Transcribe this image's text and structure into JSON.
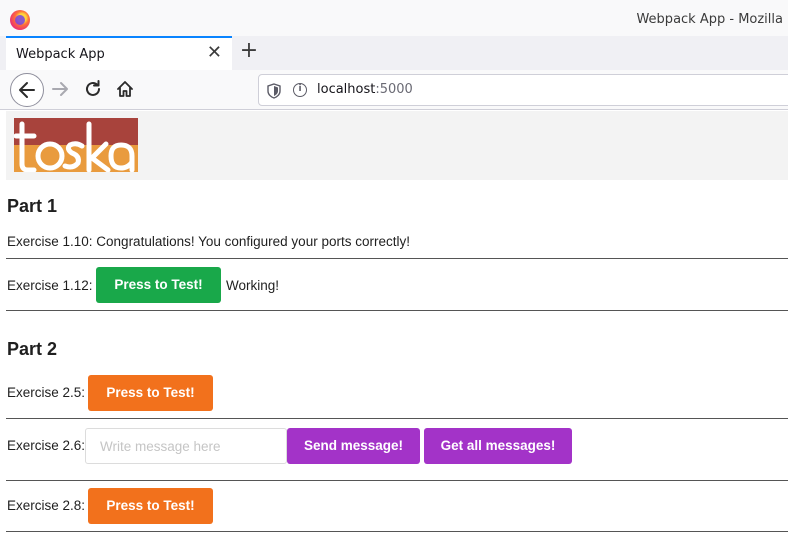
{
  "browser": {
    "window_title": "Webpack App - Mozilla",
    "tab_title": "Webpack App",
    "url_host": "localhost",
    "url_port": ":5000"
  },
  "part1": {
    "title": "Part 1",
    "ex110": {
      "text": "Exercise 1.10: Congratulations! You configured your ports correctly!"
    },
    "ex112": {
      "label": "Exercise 1.12:",
      "button": "Press to Test!",
      "result": "Working!"
    }
  },
  "part2": {
    "title": "Part 2",
    "ex25": {
      "label": "Exercise 2.5:",
      "button": "Press to Test!"
    },
    "ex26": {
      "label": "Exercise 2.6:",
      "placeholder": "Write message here",
      "value": "",
      "send_button": "Send message!",
      "get_button": "Get all messages!"
    },
    "ex28": {
      "label": "Exercise 2.8:",
      "button": "Press to Test!"
    }
  },
  "colors": {
    "green": "#19a84a",
    "orange": "#f2711c",
    "purple": "#a333c8",
    "logo_red": "#a8433c",
    "logo_orange": "#e99b3e"
  }
}
